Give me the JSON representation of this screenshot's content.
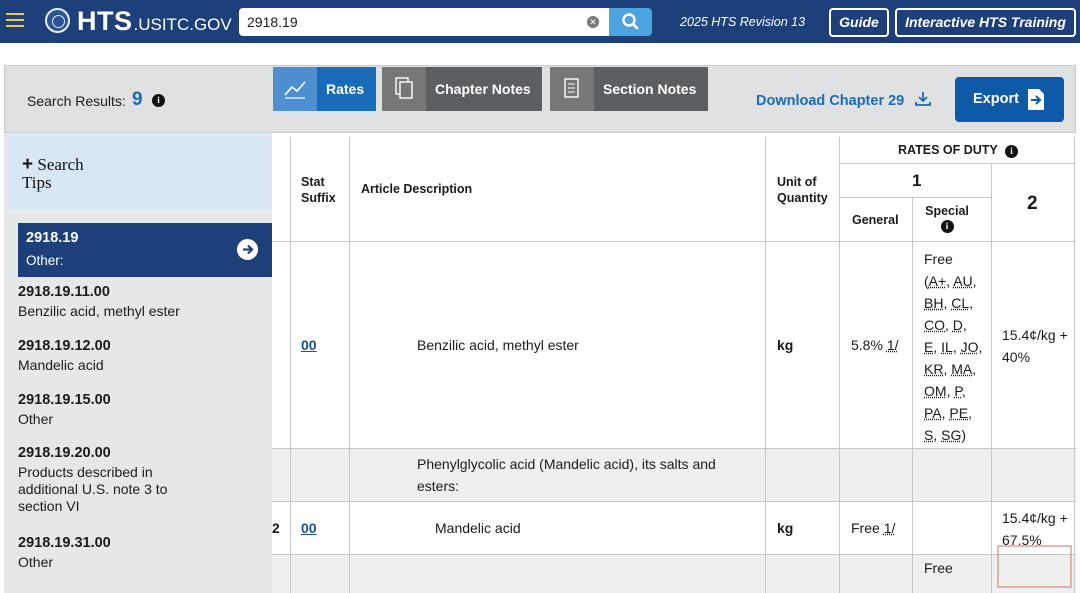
{
  "header": {
    "logo_main": "HTS",
    "logo_sub": ".USITC.GOV",
    "search_value": "2918.19",
    "revision": "2025 HTS Revision 13",
    "guide_label": "Guide",
    "training_label": "Interactive HTS Training",
    "accent_color": "#f2c83b",
    "bg_color": "#1d3f7a"
  },
  "toolbar": {
    "results_label": "Search Results:",
    "results_count": "9",
    "tabs": [
      {
        "label": "Rates",
        "icon": "chart-trend-icon",
        "active": true
      },
      {
        "label": "Chapter Notes",
        "icon": "documents-icon",
        "active": false
      },
      {
        "label": "Section Notes",
        "icon": "document-icon",
        "active": false
      }
    ],
    "download_label": "Download Chapter 29",
    "export_label": "Export"
  },
  "sidebar": {
    "tips_plus": "+",
    "tips_label": "Search",
    "tips_label2": "Tips",
    "active": {
      "code": "2918.19",
      "desc": "Other:"
    },
    "items": [
      {
        "code": "2918.19.11.00",
        "desc": "Benzilic acid, methyl ester"
      },
      {
        "code": "2918.19.12.00",
        "desc": "Mandelic acid"
      },
      {
        "code": "2918.19.15.00",
        "desc": "Other"
      },
      {
        "code": "2918.19.20.00",
        "desc": "Products described in additional U.S. note 3 to section VI"
      },
      {
        "code": "2918.19.31.00",
        "desc": "Other"
      }
    ]
  },
  "table": {
    "headers": {
      "stat_suffix": "Stat Suffix",
      "article_description": "Article Description",
      "unit_of_quantity": "Unit of Quantity",
      "rates_of_duty": "RATES OF DUTY",
      "col1": "1",
      "col2": "2",
      "general": "General",
      "special": "Special"
    },
    "rows": [
      {
        "stat": "00",
        "description": "Benzilic acid, methyl ester",
        "unit": "kg",
        "general": "5.8%",
        "general_note": "1/",
        "special_prefix": "Free",
        "special_codes": [
          "A+",
          "AU",
          "BH",
          "CL",
          "CO",
          "D",
          "E",
          "IL",
          "JO",
          "KR",
          "MA",
          "OM",
          "P",
          "PA",
          "PE",
          "S",
          "SG"
        ],
        "col2": "15.4¢/kg + 40%"
      },
      {
        "stat": "",
        "description": "Phenylglycolic acid (Mandelic acid), its salts and esters:",
        "unit": "",
        "general": "",
        "col2": ""
      },
      {
        "stat": "00",
        "digit_fragment": "2",
        "description": "Mandelic acid",
        "unit": "kg",
        "general": "Free",
        "general_note": "1/",
        "col2": "15.4¢/kg + 67.5%"
      },
      {
        "special_prefix": "Free"
      }
    ]
  }
}
